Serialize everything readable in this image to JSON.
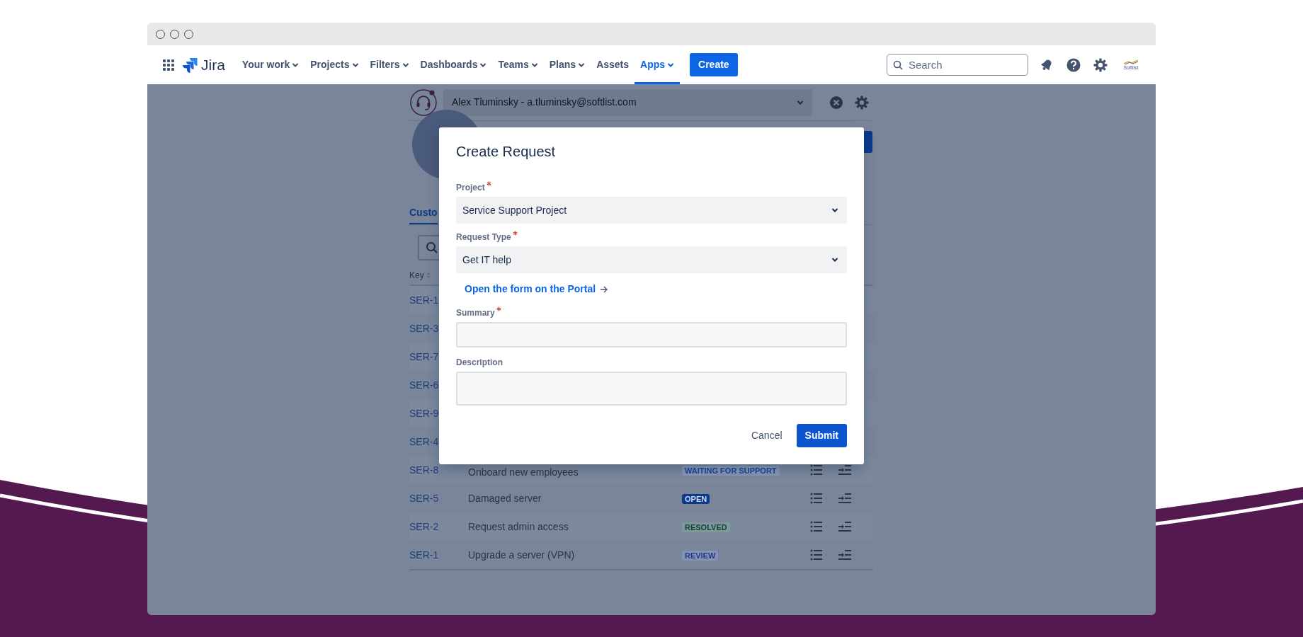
{
  "navbar": {
    "product": "Jira",
    "items": [
      {
        "label": "Your work",
        "dropdown": true,
        "selected": false
      },
      {
        "label": "Projects",
        "dropdown": true,
        "selected": false
      },
      {
        "label": "Filters",
        "dropdown": true,
        "selected": false
      },
      {
        "label": "Dashboards",
        "dropdown": true,
        "selected": false
      },
      {
        "label": "Teams",
        "dropdown": true,
        "selected": false
      },
      {
        "label": "Plans",
        "dropdown": true,
        "selected": false
      },
      {
        "label": "Assets",
        "dropdown": false,
        "selected": false
      },
      {
        "label": "Apps",
        "dropdown": true,
        "selected": true
      }
    ],
    "create_button": "Create",
    "search": {
      "placeholder": "Search"
    },
    "logo_text": "Softlist"
  },
  "agent_bar": {
    "value": "Alex Tluminsky - a.tluminsky@softlist.com"
  },
  "tabs": [
    {
      "label": "Custo",
      "selected": true
    }
  ],
  "table": {
    "columns": [
      "Key"
    ],
    "rows": [
      {
        "key": "SER-1"
      },
      {
        "key": "SER-3"
      },
      {
        "key": "SER-7"
      },
      {
        "key": "SER-6"
      },
      {
        "key": "SER-9"
      },
      {
        "key": "SER-4"
      },
      {
        "key": "SER-8",
        "summary": "Onboard new employees",
        "status": {
          "label": "WAITING FOR SUPPORT",
          "kind": "waiting"
        }
      },
      {
        "key": "SER-5",
        "summary": "Damaged server",
        "status": {
          "label": "OPEN",
          "kind": "open"
        }
      },
      {
        "key": "SER-2",
        "summary": "Request admin access",
        "status": {
          "label": "RESOLVED",
          "kind": "resolved"
        }
      },
      {
        "key": "SER-1",
        "summary": "Upgrade a server (VPN)",
        "status": {
          "label": "REVIEW",
          "kind": "review"
        }
      }
    ]
  },
  "modal": {
    "title": "Create Request",
    "fields": [
      {
        "label": "Project",
        "required": true,
        "kind": "select",
        "value": "Service Support Project"
      },
      {
        "label": "Request Type",
        "required": true,
        "kind": "select",
        "value": "Get IT help"
      },
      {
        "label": "Open the form on the Portal",
        "kind": "link"
      },
      {
        "label": "Summary",
        "required": true,
        "kind": "input"
      },
      {
        "label": "Description",
        "required": false,
        "kind": "textarea"
      }
    ],
    "cancel": "Cancel",
    "submit": "Submit"
  }
}
